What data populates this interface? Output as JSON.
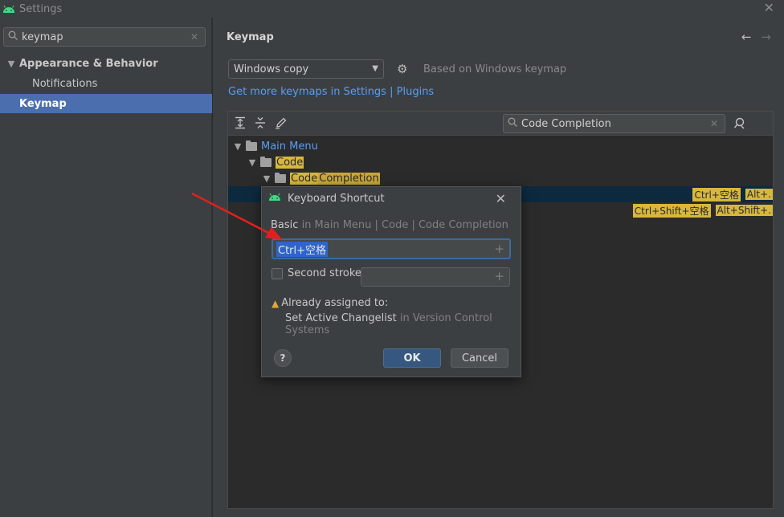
{
  "window": {
    "title": "Settings",
    "close_glyph": "✕"
  },
  "sidebar": {
    "search": {
      "value": "keymap",
      "placeholder": ""
    },
    "items": [
      {
        "label": "Appearance & Behavior"
      },
      {
        "label": "Notifications"
      },
      {
        "label": "Keymap"
      }
    ]
  },
  "main": {
    "title": "Keymap",
    "keymap_select": "Windows copy",
    "based_on": "Based on Windows keymap",
    "link_get_more": "Get more keymaps in Settings",
    "link_separator": "|",
    "link_plugins": "Plugins",
    "action_search": {
      "value": "Code Completion"
    },
    "tree": [
      {
        "label": "Main Menu"
      },
      {
        "label": "Code"
      },
      {
        "label_part1": "Code",
        "label_part2": "Completion"
      }
    ],
    "shortcuts_row1": [
      "Ctrl+空格",
      "Alt+."
    ],
    "shortcuts_row2": [
      "Ctrl+Shift+空格",
      "Alt+Shift+."
    ]
  },
  "dialog": {
    "title": "Keyboard Shortcut",
    "path_name": "Basic",
    "path_rest": "in Main Menu | Code | Code Completion",
    "shortcut_value": "Ctrl+空格",
    "second_stroke_label": "Second stroke:",
    "second_stroke_checked": false,
    "warning": "Already assigned to:",
    "assigned_action": "Set Active Changelist",
    "assigned_location": "in Version Control Systems",
    "help_label": "?",
    "ok_label": "OK",
    "cancel_label": "Cancel"
  },
  "colors": {
    "accent_selection": "#4b6eaf",
    "highlight": "#d7b73e",
    "link": "#589df6",
    "annotation_arrow": "#e02020",
    "android_green": "#3ddc84"
  },
  "icons": {
    "app": "android-icon",
    "search": "search-icon",
    "gear": "gear-icon",
    "back": "arrow-left-icon",
    "forward": "arrow-right-icon"
  }
}
